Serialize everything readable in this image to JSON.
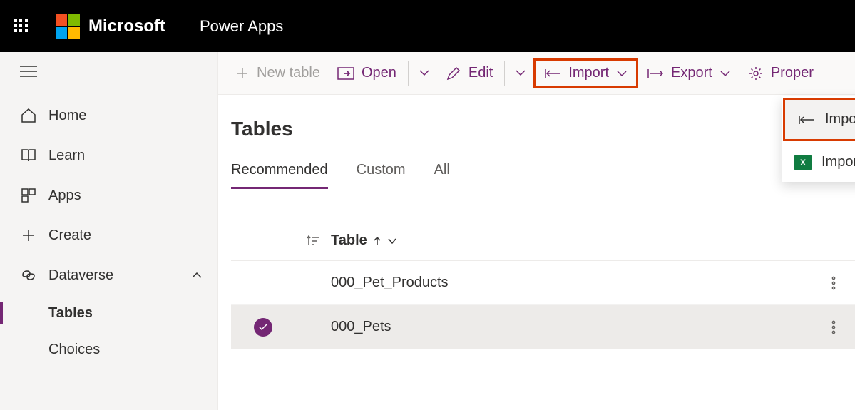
{
  "header": {
    "brand": "Microsoft",
    "app": "Power Apps"
  },
  "sidebar": {
    "items": [
      {
        "label": "Home"
      },
      {
        "label": "Learn"
      },
      {
        "label": "Apps"
      },
      {
        "label": "Create"
      },
      {
        "label": "Dataverse",
        "expanded": true
      }
    ],
    "subitems": [
      {
        "label": "Tables",
        "active": true
      },
      {
        "label": "Choices"
      }
    ]
  },
  "toolbar": {
    "new_table": "New table",
    "open": "Open",
    "edit": "Edit",
    "import": "Import",
    "export": "Export",
    "properties": "Proper"
  },
  "dropdown": {
    "import_data": "Import data",
    "import_excel": "Import data from Excel"
  },
  "page": {
    "title": "Tables"
  },
  "tabs": [
    {
      "label": "Recommended",
      "active": true
    },
    {
      "label": "Custom"
    },
    {
      "label": "All"
    }
  ],
  "table": {
    "header": "Table",
    "rows": [
      {
        "name": "000_Pet_Products",
        "selected": false
      },
      {
        "name": "000_Pets",
        "selected": true
      }
    ]
  }
}
